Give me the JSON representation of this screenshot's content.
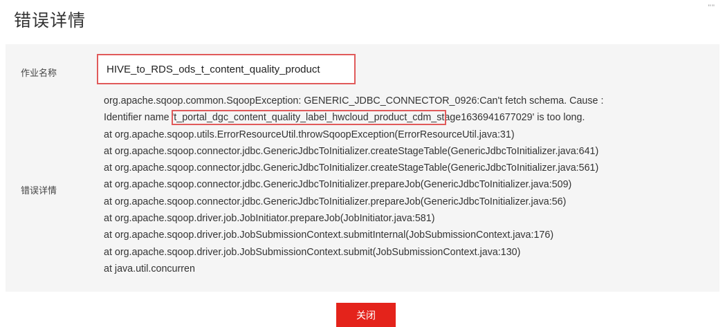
{
  "dialog": {
    "title": "错误详情",
    "close_mark": "\"\"",
    "job_name_label": "作业名称",
    "job_name_value": "HIVE_to_RDS_ods_t_content_quality_product",
    "error_detail_label": "错误详情",
    "error_lines": [
      "org.apache.sqoop.common.SqoopException: GENERIC_JDBC_CONNECTOR_0926:Can't fetch schema. Cause :",
      "at org.apache.sqoop.utils.ErrorResourceUtil.throwSqoopException(ErrorResourceUtil.java:31)",
      "at org.apache.sqoop.connector.jdbc.GenericJdbcToInitializer.createStageTable(GenericJdbcToInitializer.java:641)",
      "at org.apache.sqoop.connector.jdbc.GenericJdbcToInitializer.createStageTable(GenericJdbcToInitializer.java:561)",
      "at org.apache.sqoop.connector.jdbc.GenericJdbcToInitializer.prepareJob(GenericJdbcToInitializer.java:509)",
      "at org.apache.sqoop.connector.jdbc.GenericJdbcToInitializer.prepareJob(GenericJdbcToInitializer.java:56)",
      "at org.apache.sqoop.driver.job.JobInitiator.prepareJob(JobInitiator.java:581)",
      "at org.apache.sqoop.driver.job.JobSubmissionContext.submitInternal(JobSubmissionContext.java:176)",
      "at org.apache.sqoop.driver.job.JobSubmissionContext.submit(JobSubmissionContext.java:130)",
      "at java.util.concurren"
    ],
    "identifier_line": {
      "prefix": "Identifier name '",
      "highlighted": "t_portal_dgc_content_quality_label_hwcloud_product_cdm_st",
      "suffix": "age1636941677029' is too long."
    },
    "close_button_label": "关闭"
  },
  "colors": {
    "accent_red": "#e4231b",
    "highlight_border": "#e05a5a",
    "panel_background": "#f5f5f5"
  }
}
